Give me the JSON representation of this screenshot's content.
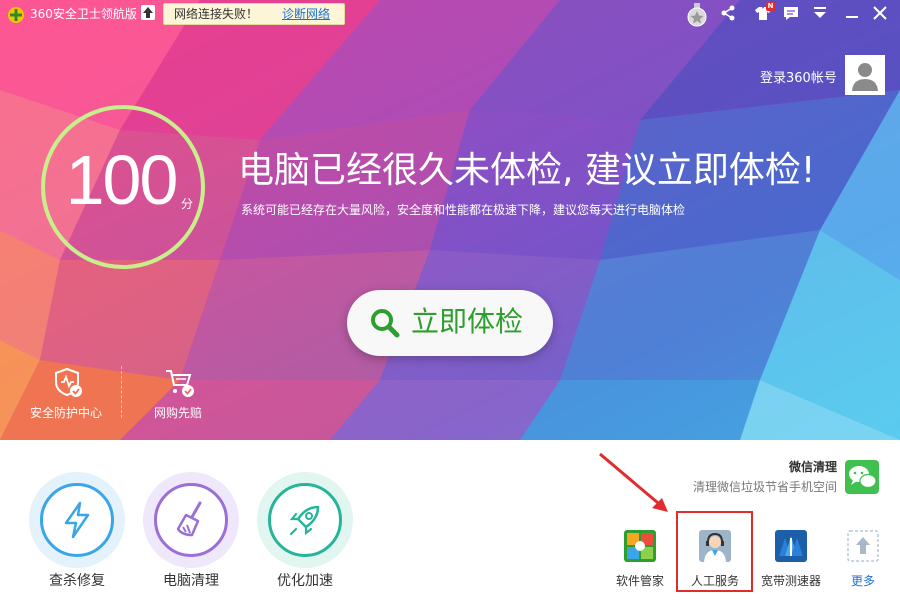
{
  "titlebar": {
    "title": "360安全卫士领航版",
    "net_message": "网络连接失败！",
    "net_link": "诊断网络",
    "icons": [
      "medal-icon",
      "share-icon",
      "shirt-icon",
      "message-icon",
      "menu-icon",
      "minimize-icon",
      "close-icon"
    ],
    "new_badge": "N"
  },
  "account": {
    "login_label": "登录360帐号"
  },
  "score": {
    "value": "100",
    "unit": "分",
    "ring_fill": 1.0
  },
  "headline": "电脑已经很久未体检, 建议立即体检!",
  "subline": "系统可能已经存在大量风险，安全度和性能都在极速下降，建议您每天进行电脑体检",
  "check_button": {
    "label": "立即体检"
  },
  "hero_shortcuts": [
    {
      "label": "安全防护中心",
      "icon": "shield-check-icon"
    },
    {
      "label": "网购先赔",
      "icon": "cart-check-icon"
    }
  ],
  "tools": [
    {
      "label": "查杀修复",
      "icon": "lightning-icon",
      "color": "#3aa6e8"
    },
    {
      "label": "电脑清理",
      "icon": "broom-icon",
      "color": "#9a6fd8"
    },
    {
      "label": "优化加速",
      "icon": "rocket-icon",
      "color": "#26b59a"
    }
  ],
  "wechat": {
    "title": "微信清理",
    "description": "清理微信垃圾节省手机空间",
    "icon": "wechat-icon"
  },
  "apps": [
    {
      "label": "软件管家",
      "icon": "software-manager-icon"
    },
    {
      "label": "人工服务",
      "icon": "customer-service-icon",
      "highlighted": true
    },
    {
      "label": "宽带测速器",
      "icon": "speedometer-icon"
    },
    {
      "label": "更多",
      "icon": "more-upload-icon",
      "accent": "#1d72d8"
    }
  ],
  "colors": {
    "accent_green": "#2e9f2e",
    "link_blue": "#1d72d8",
    "highlight_red": "#e22b2b"
  }
}
